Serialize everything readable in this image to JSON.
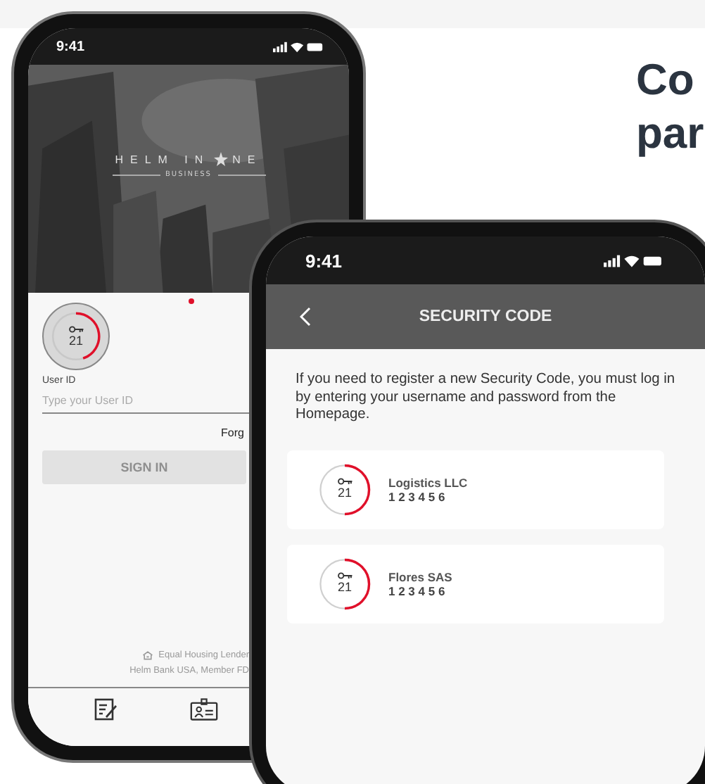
{
  "heading": {
    "lines": [
      "Co",
      "par"
    ]
  },
  "login_phone": {
    "status_bar": {
      "time": "9:41"
    },
    "brand": {
      "name_left": "HELM IN",
      "name_right": "NE",
      "tagline": "BUSINESS"
    },
    "token": {
      "code": "21",
      "level": 0.45
    },
    "notice_dot": true,
    "user_id": {
      "label": "User ID",
      "placeholder": "Type your User ID"
    },
    "forgot_link": "Forg",
    "sign_in": {
      "label": "SIGN IN",
      "disabled": true
    },
    "footer": [
      "Equal Housing Lender",
      "Helm Bank USA, Member FD"
    ]
  },
  "code_phone": {
    "status_bar": {
      "time": "9:41"
    },
    "title": "SECURITY CODE",
    "message": "If you need to register a new Security Code, you must log in by entering your username and password from the Homepage.",
    "accounts": [
      {
        "name": "Logistics LLC",
        "code": "1 2 3 4 5 6",
        "timer": "21",
        "level": 0.5
      },
      {
        "name": "Flores SAS",
        "code": "1 2 3 4 5 6",
        "timer": "21",
        "level": 0.5
      }
    ]
  }
}
